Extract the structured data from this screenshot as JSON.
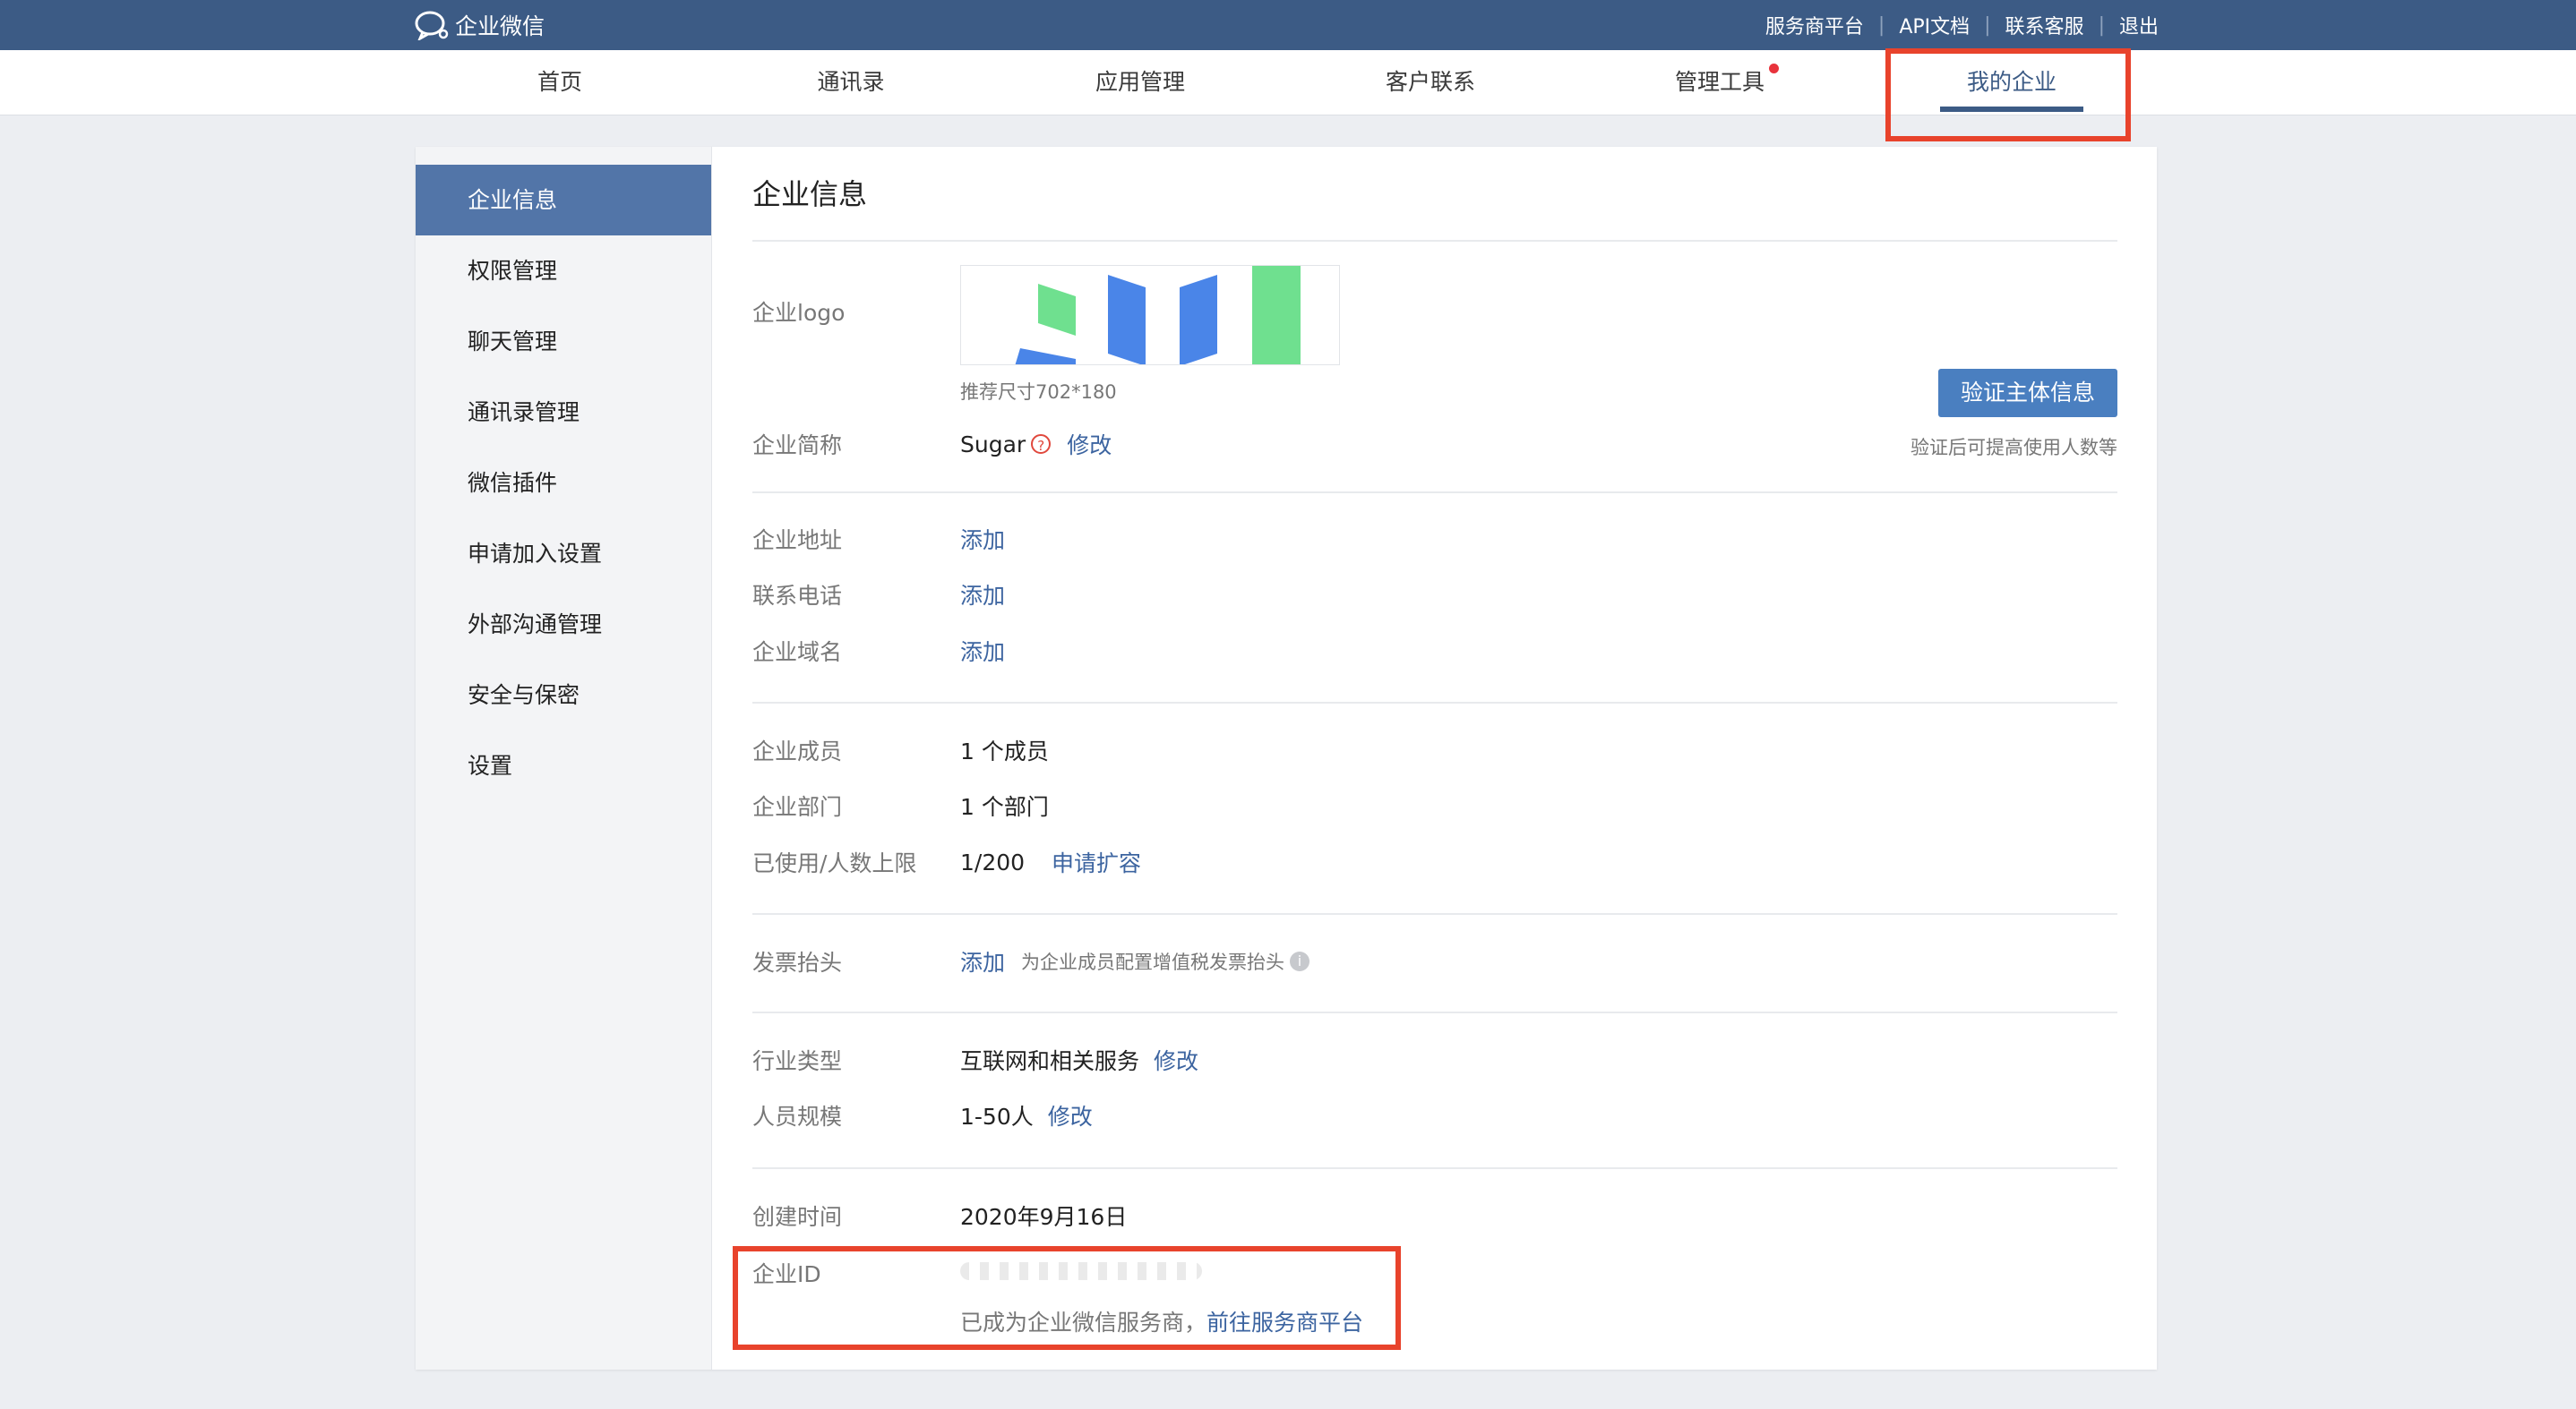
{
  "topbar": {
    "brand": "企业微信",
    "links": [
      "服务商平台",
      "API文档",
      "联系客服",
      "退出"
    ]
  },
  "nav": {
    "items": [
      "首页",
      "通讯录",
      "应用管理",
      "客户联系",
      "管理工具",
      "我的企业"
    ],
    "active": "我的企业"
  },
  "sidebar": {
    "items": [
      "企业信息",
      "权限管理",
      "聊天管理",
      "通讯录管理",
      "微信插件",
      "申请加入设置",
      "外部沟通管理",
      "安全与保密",
      "设置"
    ]
  },
  "main": {
    "title": "企业信息",
    "logo_label": "企业logo",
    "logo_hint": "推荐尺寸702*180",
    "verify_button": "验证主体信息",
    "verify_note": "验证后可提高使用人数等",
    "short_name_label": "企业简称",
    "short_name_value": "Sugar",
    "edit_link": "修改",
    "address_label": "企业地址",
    "phone_label": "联系电话",
    "domain_label": "企业域名",
    "add_link": "添加",
    "members_label": "企业成员",
    "members_value": "1 个成员",
    "departments_label": "企业部门",
    "departments_value": "1 个部门",
    "limit_label": "已使用/人数上限",
    "limit_value": "1/200",
    "expand_link": "申请扩容",
    "invoice_label": "发票抬头",
    "invoice_hint": "为企业成员配置增值税发票抬头",
    "industry_label": "行业类型",
    "industry_value": "互联网和相关服务",
    "scale_label": "人员规模",
    "scale_value": "1-50人",
    "created_label": "创建时间",
    "created_value": "2020年9月16日",
    "corp_id_label": "企业ID",
    "provider_note": "已成为企业微信服务商，",
    "provider_link": "前往服务商平台"
  },
  "colors": {
    "topbar": "#3c5b85",
    "link": "#3c64a0",
    "sidebar_active": "#5275a8",
    "verify_button": "#4a7fc0",
    "highlight": "#e8432c"
  }
}
